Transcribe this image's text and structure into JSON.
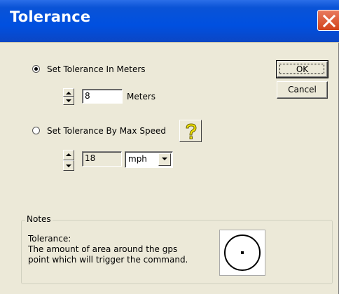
{
  "window": {
    "title": "Tolerance"
  },
  "options": {
    "meters": {
      "label": "Set Tolerance In Meters",
      "selected": true,
      "value": "8",
      "unit": "Meters"
    },
    "speed": {
      "label": "Set Tolerance By Max Speed",
      "selected": false,
      "value": "18",
      "unit_selected": "mph"
    }
  },
  "buttons": {
    "ok": "OK",
    "cancel": "Cancel"
  },
  "notes": {
    "legend": "Notes",
    "line1": "Tolerance:",
    "line2": "The amount of area around the gps",
    "line3": "point which will trigger the command."
  },
  "icons": {
    "close": "close-icon",
    "help": "question-mark-icon",
    "spin_up": "up-arrow-icon",
    "spin_down": "down-arrow-icon",
    "dropdown": "chevron-down-icon"
  },
  "colors": {
    "titlebar": "#0050e0",
    "close": "#d2431b",
    "dialog_bg": "#ece9d8",
    "help_icon": "#f2e300"
  }
}
